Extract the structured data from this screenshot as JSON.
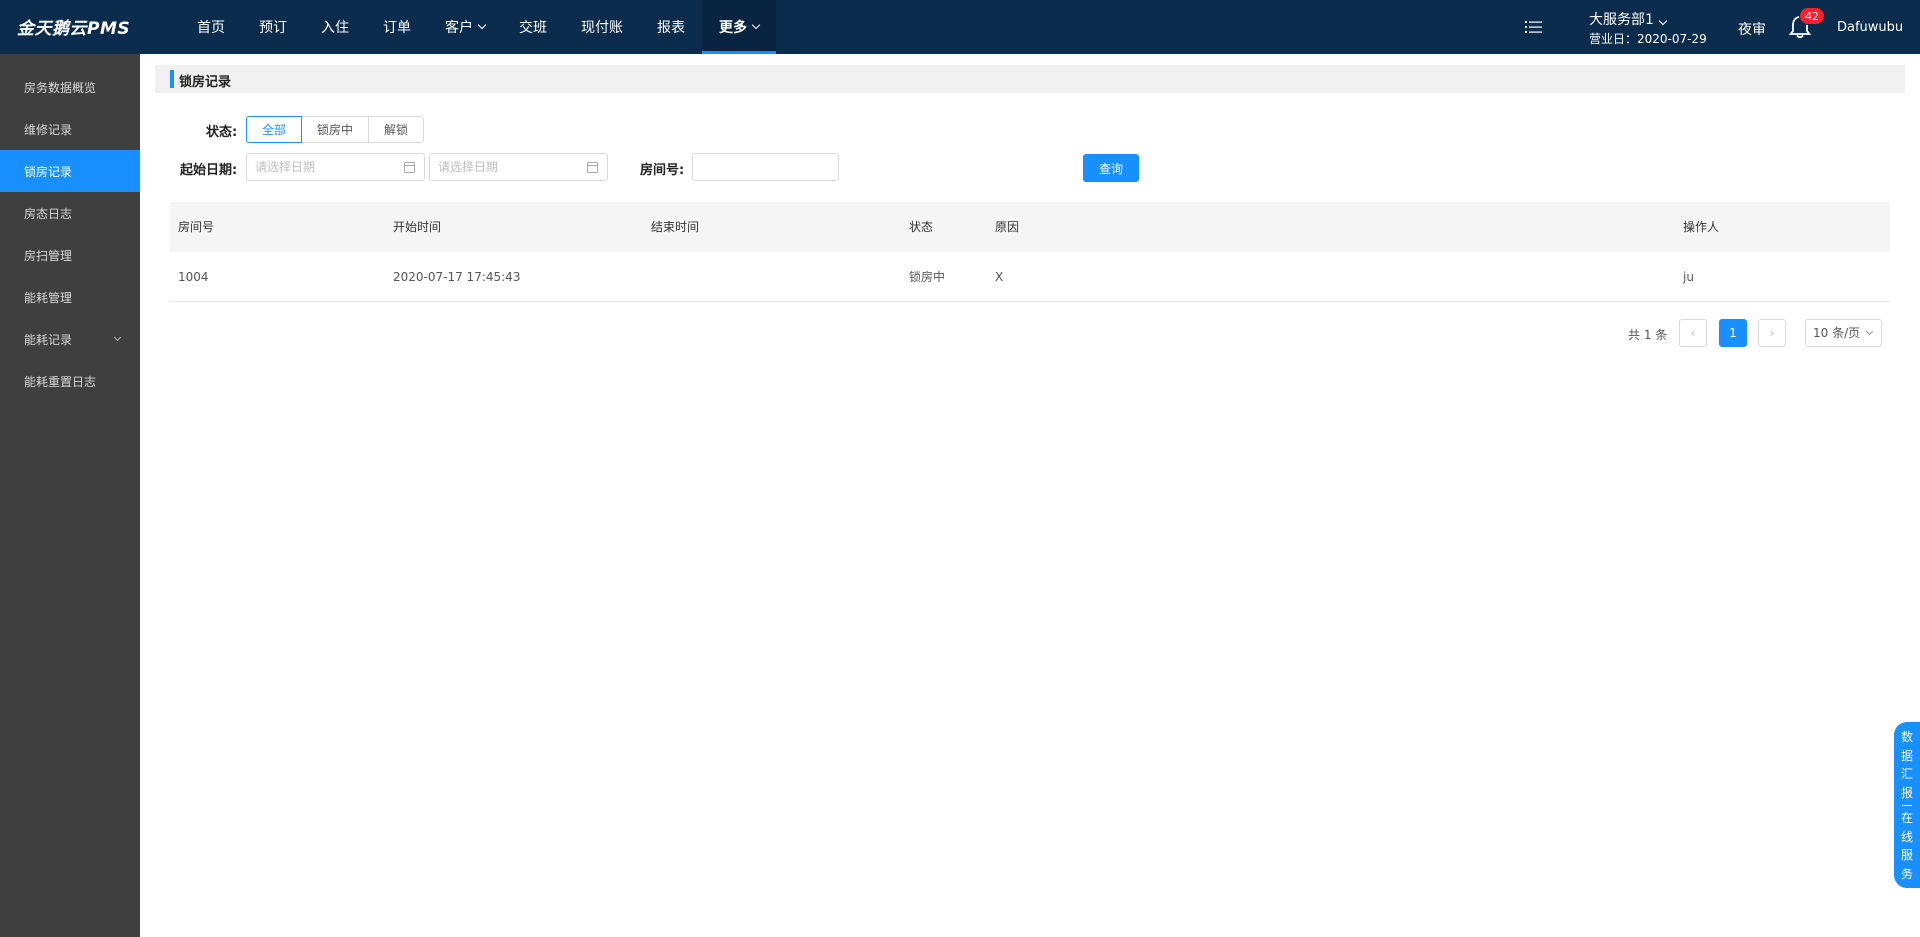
{
  "app": {
    "brand": "金天鹅云PMS"
  },
  "nav": {
    "items": [
      {
        "label": "首页"
      },
      {
        "label": "预订"
      },
      {
        "label": "入住"
      },
      {
        "label": "订单"
      },
      {
        "label": "客户"
      },
      {
        "label": "交班"
      },
      {
        "label": "现付账"
      },
      {
        "label": "报表"
      },
      {
        "label": "更多"
      }
    ]
  },
  "header_right": {
    "department": "大服务部1",
    "business_day": "营业日：2020-07-29",
    "night_audit": "夜审",
    "notifications": "42",
    "user": "Dafuwubu"
  },
  "sidebar": {
    "items": [
      {
        "label": "房务数据概览"
      },
      {
        "label": "维修记录"
      },
      {
        "label": "锁房记录"
      },
      {
        "label": "房态日志"
      },
      {
        "label": "房扫管理"
      },
      {
        "label": "能耗管理"
      },
      {
        "label": "能耗记录"
      },
      {
        "label": "能耗重置日志"
      }
    ]
  },
  "page": {
    "title": "锁房记录"
  },
  "filters": {
    "status_label": "状态:",
    "status_options": [
      "全部",
      "锁房中",
      "解锁"
    ],
    "status_selected": "全部",
    "date_label": "起始日期:",
    "date_start_placeholder": "请选择日期",
    "date_end_placeholder": "请选择日期",
    "room_label": "房间号:",
    "room_value": "",
    "query_button": "查询"
  },
  "table": {
    "columns": [
      "房间号",
      "开始时间",
      "结束时间",
      "状态",
      "原因",
      "操作人"
    ],
    "rows": [
      {
        "room": "1004",
        "start": "2020-07-17 17:45:43",
        "end": "",
        "status": "锁房中",
        "reason": "X",
        "operator": "ju"
      }
    ]
  },
  "pagination": {
    "total": "共 1 条",
    "prev": "‹",
    "current": "1",
    "next": "›",
    "page_size": "10 条/页"
  },
  "float_tab": {
    "part1": [
      "数",
      "据",
      "汇",
      "报"
    ],
    "part2": [
      "在",
      "线",
      "服",
      "务"
    ]
  },
  "colors": {
    "topbar": "#0b2c4d",
    "sidebar": "#3f3f3f",
    "accent": "#1890ff",
    "badge": "#f5222d"
  },
  "icons": [
    "list-icon",
    "bell-icon",
    "calendar-icon",
    "chevron-down-icon"
  ]
}
